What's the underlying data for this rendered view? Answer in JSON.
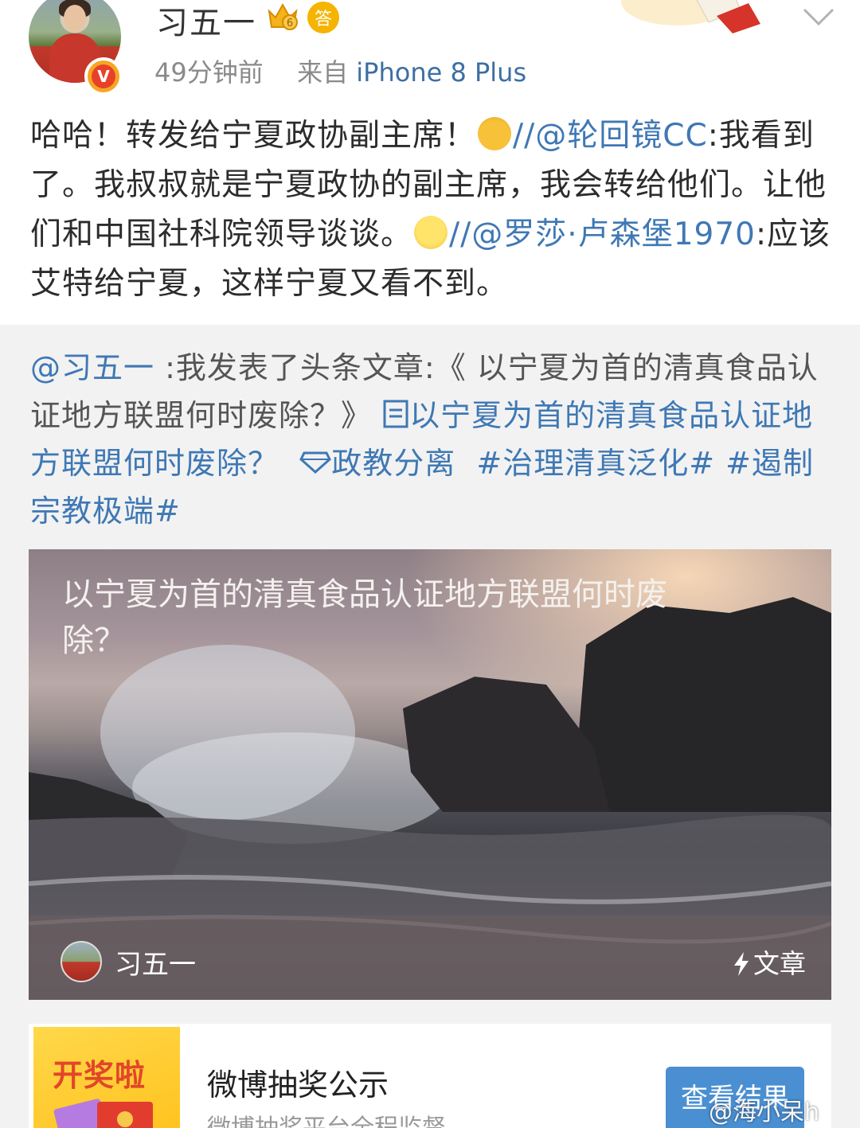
{
  "header": {
    "username": "习五一",
    "answer_badge": "答",
    "time": "49分钟前",
    "source_prefix": "来自",
    "device": "iPhone 8 Plus"
  },
  "repost": {
    "seg1": "哈哈！转发给宁夏政协副主席！",
    "sep1": "//",
    "mention1": "@轮回镜CC",
    "seg2": ":我看到了。我叔叔就是宁夏政协的副主席，我会转给他们。让他们和中国社科院领导谈谈。",
    "sep2": "//",
    "mention2": "@罗莎·卢森堡1970",
    "seg3": ":应该艾特给宁夏，这样宁夏又看不到。"
  },
  "original": {
    "mention": "@习五一",
    "text": " :我发表了头条文章:《 以宁夏为首的清真食品认证地方联盟何时废除？》",
    "article_link": "以宁夏为首的清真食品认证地方联盟何时废除？",
    "topic": "政教分离",
    "hashtag1": "#治理清真泛化#",
    "hashtag2": "#遏制宗教极端#"
  },
  "article_card": {
    "title": "以宁夏为首的清真食品认证地方联盟何时废除？",
    "author": "习五一",
    "tag": "文章"
  },
  "lottery": {
    "thumb_text": "开奖啦",
    "title": "微博抽奖公示",
    "subtitle": "微博抽奖平台全程监督",
    "button": "查看结果"
  },
  "watermark": "@海小呆h"
}
